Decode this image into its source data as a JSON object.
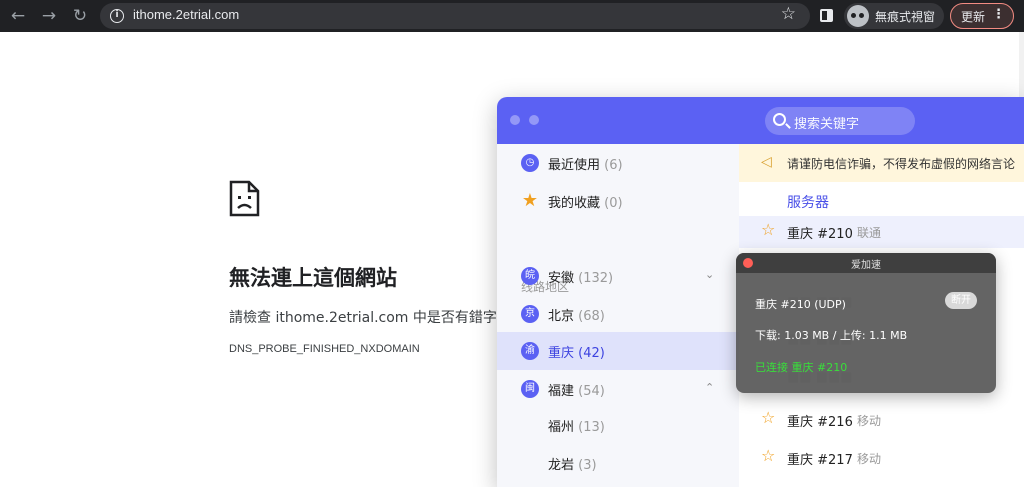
{
  "browser": {
    "nav_back_icon": "arrow-left-icon",
    "nav_forward_icon": "arrow-right-icon",
    "nav_reload_icon": "reload-icon",
    "url": "ithome.2etrial.com",
    "incognito_label": "無痕式視窗",
    "update_label": "更新"
  },
  "error_page": {
    "title": "無法連上這個網站",
    "message": "請檢查 ithome.2etrial.com 中是否有錯字。",
    "code": "DNS_PROBE_FINISHED_NXDOMAIN"
  },
  "app": {
    "accent": "#5b61f3",
    "search_placeholder": "搜索关键字",
    "sidebar": {
      "recent": {
        "label": "最近使用",
        "count": "(6)",
        "icon": "clock-icon"
      },
      "favorites": {
        "label": "我的收藏",
        "count": "(0)",
        "icon": "star-icon"
      },
      "section_label": "线路地区",
      "regions": [
        {
          "badge": "皖",
          "label": "安徽",
          "count": "(132)",
          "expand": "⌄"
        },
        {
          "badge": "京",
          "label": "北京",
          "count": "(68)"
        },
        {
          "badge": "渝",
          "label": "重庆",
          "count": "(42)"
        },
        {
          "badge": "闽",
          "label": "福建",
          "count": "(54)",
          "expand": "⌃"
        }
      ],
      "subregions": [
        {
          "label": "福州",
          "count": "(13)"
        },
        {
          "label": "龙岩",
          "count": "(3)"
        }
      ]
    },
    "notice": "请谨防电信诈骗，不得发布虚假的网络言论",
    "server_heading": "服务器",
    "servers": [
      {
        "name": "重庆 #210",
        "isp": "联通"
      },
      {
        "name": "重庆 #216",
        "isp": "移动"
      },
      {
        "name": "重庆 #217",
        "isp": "移动"
      }
    ]
  },
  "popup": {
    "title": "爱加速",
    "server": "重庆 #210 (UDP)",
    "disconnect_label": "断开",
    "traffic": "下载: 1.03 MB / 上传: 1.1 MB",
    "status": "已连接 重庆 #210",
    "status_color": "#38e03a"
  }
}
